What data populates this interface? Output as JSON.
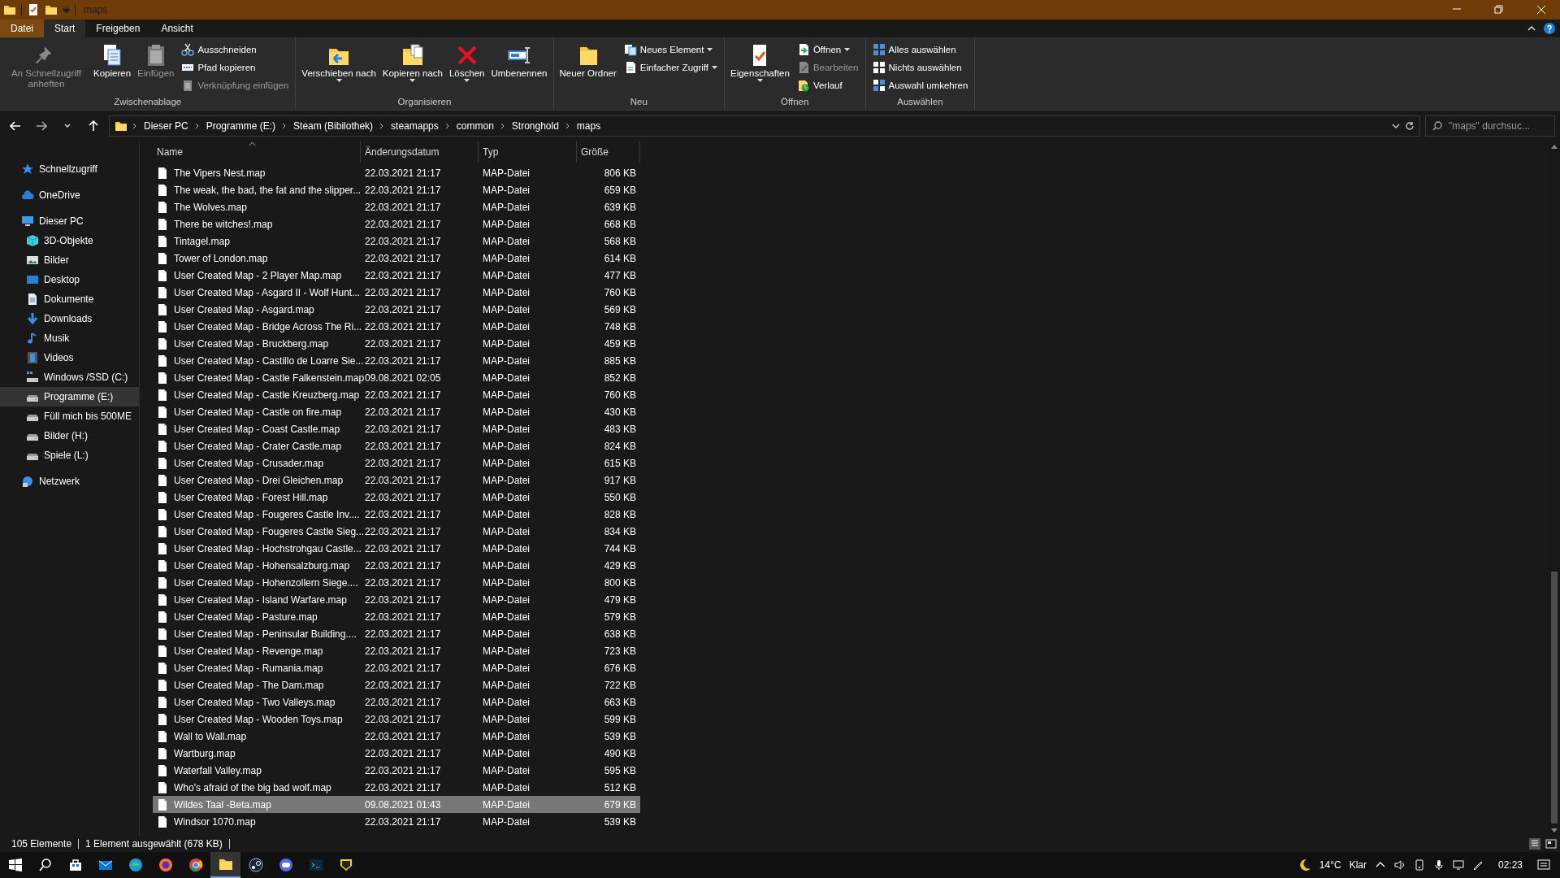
{
  "window": {
    "title": "maps"
  },
  "ribbon_tabs": [
    {
      "label": "Datei",
      "kind": "file",
      "selected": false
    },
    {
      "label": "Start",
      "kind": "tab",
      "selected": true
    },
    {
      "label": "Freigeben",
      "kind": "tab",
      "selected": false
    },
    {
      "label": "Ansicht",
      "kind": "tab",
      "selected": false
    }
  ],
  "ribbon_groups": [
    {
      "label": "Zwischenablage",
      "buttons": [
        {
          "kind": "pin",
          "label": "An Schnellzugriff anheften",
          "disabled": true
        },
        {
          "kind": "copy",
          "label": "Kopieren",
          "disabled": false
        },
        {
          "kind": "paste",
          "label": "Einfügen",
          "disabled": true
        }
      ],
      "small_buttons": [
        {
          "kind": "cut",
          "label": "Ausschneiden",
          "disabled": false
        },
        {
          "kind": "path",
          "label": "Pfad kopieren",
          "disabled": false
        },
        {
          "kind": "shortcut",
          "label": "Verknüpfung einfügen",
          "disabled": true
        }
      ]
    },
    {
      "label": "Organisieren",
      "buttons": [
        {
          "kind": "move",
          "label": "Verschieben nach",
          "dropdown": true,
          "disabled": false
        },
        {
          "kind": "copyto",
          "label": "Kopieren nach",
          "dropdown": true,
          "disabled": false
        },
        {
          "kind": "delete",
          "label": "Löschen",
          "dropdown": true,
          "disabled": false
        },
        {
          "kind": "rename",
          "label": "Umbenennen",
          "disabled": false
        }
      ]
    },
    {
      "label": "Neu",
      "buttons": [
        {
          "kind": "newfolder",
          "label": "Neuer Ordner",
          "disabled": false
        }
      ],
      "small_buttons": [
        {
          "kind": "newitem",
          "label": "Neues Element",
          "dropdown": true,
          "disabled": false
        },
        {
          "kind": "easyaccess",
          "label": "Einfacher Zugriff",
          "dropdown": true,
          "disabled": false
        }
      ]
    },
    {
      "label": "Öffnen",
      "buttons": [
        {
          "kind": "properties",
          "label": "Eigenschaften",
          "dropdown": true,
          "disabled": false
        }
      ],
      "small_buttons": [
        {
          "kind": "open",
          "label": "Öffnen",
          "dropdown": true,
          "disabled": false
        },
        {
          "kind": "edit",
          "label": "Bearbeiten",
          "disabled": true
        },
        {
          "kind": "history",
          "label": "Verlauf",
          "disabled": false
        }
      ]
    },
    {
      "label": "Auswählen",
      "small_buttons": [
        {
          "kind": "selectall",
          "label": "Alles auswählen",
          "disabled": false
        },
        {
          "kind": "selectnone",
          "label": "Nichts auswählen",
          "disabled": false
        },
        {
          "kind": "invert",
          "label": "Auswahl umkehren",
          "disabled": false
        }
      ]
    }
  ],
  "breadcrumb": [
    "Dieser PC",
    "Programme (E:)",
    "Steam (Bibilothek)",
    "steamapps",
    "common",
    "Stronghold",
    "maps"
  ],
  "search": {
    "placeholder": "\"maps\" durchsuc..."
  },
  "sidebar": {
    "items": [
      {
        "label": "Schnellzugriff",
        "kind": "star",
        "selected": false
      },
      {
        "label": "OneDrive",
        "kind": "cloud",
        "selected": false
      },
      {
        "label": "Dieser PC",
        "kind": "pc",
        "selected": false,
        "children": [
          {
            "label": "3D-Objekte",
            "kind": "cube",
            "selected": false
          },
          {
            "label": "Bilder",
            "kind": "image",
            "selected": false
          },
          {
            "label": "Desktop",
            "kind": "desktop",
            "selected": false
          },
          {
            "label": "Dokumente",
            "kind": "document",
            "selected": false
          },
          {
            "label": "Downloads",
            "kind": "download",
            "selected": false
          },
          {
            "label": "Musik",
            "kind": "music",
            "selected": false
          },
          {
            "label": "Videos",
            "kind": "video",
            "selected": false
          },
          {
            "label": "Windows /SSD (C:)",
            "kind": "systemdrive",
            "selected": false
          },
          {
            "label": "Programme (E:)",
            "kind": "drive",
            "selected": true
          },
          {
            "label": "Füll mich bis 500ME",
            "kind": "drive",
            "selected": false
          },
          {
            "label": "Bilder (H:)",
            "kind": "drive",
            "selected": false
          },
          {
            "label": "Spiele (L:)",
            "kind": "drive",
            "selected": false
          }
        ]
      },
      {
        "label": "Netzwerk",
        "kind": "network",
        "selected": false
      }
    ]
  },
  "table": {
    "columns": [
      "Name",
      "Änderungsdatum",
      "Typ",
      "Größe"
    ],
    "rows": [
      {
        "name": "The Vipers Nest.map",
        "date": "22.03.2021 21:17",
        "type": "MAP-Datei",
        "size": "806 KB",
        "selected": false
      },
      {
        "name": "The weak, the bad, the fat and the slipper...",
        "date": "22.03.2021 21:17",
        "type": "MAP-Datei",
        "size": "659 KB",
        "selected": false
      },
      {
        "name": "The Wolves.map",
        "date": "22.03.2021 21:17",
        "type": "MAP-Datei",
        "size": "639 KB",
        "selected": false
      },
      {
        "name": "There be witches!.map",
        "date": "22.03.2021 21:17",
        "type": "MAP-Datei",
        "size": "668 KB",
        "selected": false
      },
      {
        "name": "Tintagel.map",
        "date": "22.03.2021 21:17",
        "type": "MAP-Datei",
        "size": "568 KB",
        "selected": false
      },
      {
        "name": "Tower of London.map",
        "date": "22.03.2021 21:17",
        "type": "MAP-Datei",
        "size": "614 KB",
        "selected": false
      },
      {
        "name": "User Created Map - 2 Player Map.map",
        "date": "22.03.2021 21:17",
        "type": "MAP-Datei",
        "size": "477 KB",
        "selected": false
      },
      {
        "name": "User Created Map - Asgard II - Wolf Hunt...",
        "date": "22.03.2021 21:17",
        "type": "MAP-Datei",
        "size": "760 KB",
        "selected": false
      },
      {
        "name": "User Created Map - Asgard.map",
        "date": "22.03.2021 21:17",
        "type": "MAP-Datei",
        "size": "569 KB",
        "selected": false
      },
      {
        "name": "User Created Map - Bridge Across The Ri...",
        "date": "22.03.2021 21:17",
        "type": "MAP-Datei",
        "size": "748 KB",
        "selected": false
      },
      {
        "name": "User Created Map - Bruckberg.map",
        "date": "22.03.2021 21:17",
        "type": "MAP-Datei",
        "size": "459 KB",
        "selected": false
      },
      {
        "name": "User Created Map - Castillo de Loarre Sie...",
        "date": "22.03.2021 21:17",
        "type": "MAP-Datei",
        "size": "885 KB",
        "selected": false
      },
      {
        "name": "User Created Map - Castle Falkenstein.map",
        "date": "09.08.2021 02:05",
        "type": "MAP-Datei",
        "size": "852 KB",
        "selected": false
      },
      {
        "name": "User Created Map - Castle Kreuzberg.map",
        "date": "22.03.2021 21:17",
        "type": "MAP-Datei",
        "size": "760 KB",
        "selected": false
      },
      {
        "name": "User Created Map - Castle on fire.map",
        "date": "22.03.2021 21:17",
        "type": "MAP-Datei",
        "size": "430 KB",
        "selected": false
      },
      {
        "name": "User Created Map - Coast Castle.map",
        "date": "22.03.2021 21:17",
        "type": "MAP-Datei",
        "size": "483 KB",
        "selected": false
      },
      {
        "name": "User Created Map - Crater Castle.map",
        "date": "22.03.2021 21:17",
        "type": "MAP-Datei",
        "size": "824 KB",
        "selected": false
      },
      {
        "name": "User Created Map - Crusader.map",
        "date": "22.03.2021 21:17",
        "type": "MAP-Datei",
        "size": "615 KB",
        "selected": false
      },
      {
        "name": "User Created Map - Drei Gleichen.map",
        "date": "22.03.2021 21:17",
        "type": "MAP-Datei",
        "size": "917 KB",
        "selected": false
      },
      {
        "name": "User Created Map - Forest Hill.map",
        "date": "22.03.2021 21:17",
        "type": "MAP-Datei",
        "size": "550 KB",
        "selected": false
      },
      {
        "name": "User Created Map - Fougeres Castle Inv....",
        "date": "22.03.2021 21:17",
        "type": "MAP-Datei",
        "size": "828 KB",
        "selected": false
      },
      {
        "name": "User Created Map - Fougeres Castle Sieg...",
        "date": "22.03.2021 21:17",
        "type": "MAP-Datei",
        "size": "834 KB",
        "selected": false
      },
      {
        "name": "User Created Map - Hochstrohgau Castle...",
        "date": "22.03.2021 21:17",
        "type": "MAP-Datei",
        "size": "744 KB",
        "selected": false
      },
      {
        "name": "User Created Map - Hohensalzburg.map",
        "date": "22.03.2021 21:17",
        "type": "MAP-Datei",
        "size": "429 KB",
        "selected": false
      },
      {
        "name": "User Created Map - Hohenzollern Siege....",
        "date": "22.03.2021 21:17",
        "type": "MAP-Datei",
        "size": "800 KB",
        "selected": false
      },
      {
        "name": "User Created Map - Island Warfare.map",
        "date": "22.03.2021 21:17",
        "type": "MAP-Datei",
        "size": "479 KB",
        "selected": false
      },
      {
        "name": "User Created Map - Pasture.map",
        "date": "22.03.2021 21:17",
        "type": "MAP-Datei",
        "size": "579 KB",
        "selected": false
      },
      {
        "name": "User Created Map - Peninsular Building....",
        "date": "22.03.2021 21:17",
        "type": "MAP-Datei",
        "size": "638 KB",
        "selected": false
      },
      {
        "name": "User Created Map - Revenge.map",
        "date": "22.03.2021 21:17",
        "type": "MAP-Datei",
        "size": "723 KB",
        "selected": false
      },
      {
        "name": "User Created Map - Rumania.map",
        "date": "22.03.2021 21:17",
        "type": "MAP-Datei",
        "size": "676 KB",
        "selected": false
      },
      {
        "name": "User Created Map - The Dam.map",
        "date": "22.03.2021 21:17",
        "type": "MAP-Datei",
        "size": "722 KB",
        "selected": false
      },
      {
        "name": "User Created Map - Two Valleys.map",
        "date": "22.03.2021 21:17",
        "type": "MAP-Datei",
        "size": "663 KB",
        "selected": false
      },
      {
        "name": "User Created Map - Wooden Toys.map",
        "date": "22.03.2021 21:17",
        "type": "MAP-Datei",
        "size": "599 KB",
        "selected": false
      },
      {
        "name": "Wall to Wall.map",
        "date": "22.03.2021 21:17",
        "type": "MAP-Datei",
        "size": "539 KB",
        "selected": false
      },
      {
        "name": "Wartburg.map",
        "date": "22.03.2021 21:17",
        "type": "MAP-Datei",
        "size": "490 KB",
        "selected": false
      },
      {
        "name": "Waterfall Valley.map",
        "date": "22.03.2021 21:17",
        "type": "MAP-Datei",
        "size": "595 KB",
        "selected": false
      },
      {
        "name": "Who's afraid of the big bad wolf.map",
        "date": "22.03.2021 21:17",
        "type": "MAP-Datei",
        "size": "512 KB",
        "selected": false
      },
      {
        "name": "Wildes Taal -Beta.map",
        "date": "09.08.2021 01:43",
        "type": "MAP-Datei",
        "size": "679 KB",
        "selected": true
      },
      {
        "name": "Windsor 1070.map",
        "date": "22.03.2021 21:17",
        "type": "MAP-Datei",
        "size": "539 KB",
        "selected": false
      }
    ]
  },
  "status_bar": {
    "item_count": "105 Elemente",
    "selection": "1 Element ausgewählt (678 KB)"
  },
  "taskbar": {
    "apps": [
      {
        "kind": "search",
        "selected": false
      },
      {
        "kind": "store",
        "selected": false
      },
      {
        "kind": "mail",
        "selected": false
      },
      {
        "kind": "edge",
        "selected": false
      },
      {
        "kind": "firefox",
        "selected": false
      },
      {
        "kind": "chrome",
        "selected": false
      },
      {
        "kind": "folder",
        "selected": true
      },
      {
        "kind": "steam",
        "selected": false
      },
      {
        "kind": "discord",
        "selected": false
      },
      {
        "kind": "terminal",
        "selected": false
      },
      {
        "kind": "shield",
        "selected": false
      }
    ],
    "weather": {
      "temperature": "14°C",
      "condition": "Klar"
    },
    "clock": "02:23"
  }
}
